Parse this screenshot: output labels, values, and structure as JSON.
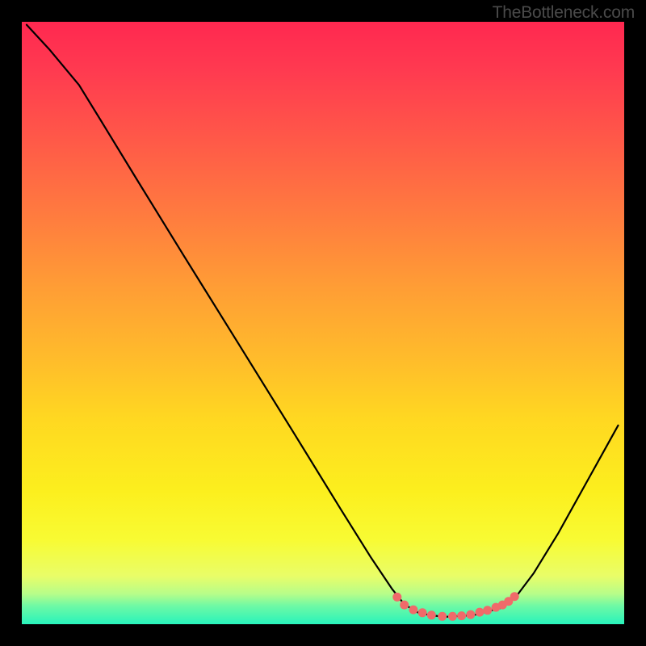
{
  "watermark": "TheBottleneck.com",
  "chart_data": {
    "type": "line",
    "title": "",
    "xlabel": "",
    "ylabel": "",
    "xlim": [
      0,
      100
    ],
    "ylim": [
      0,
      100
    ],
    "curve": [
      {
        "x": 0.8,
        "y": 99.5
      },
      {
        "x": 4.5,
        "y": 95.5
      },
      {
        "x": 9.5,
        "y": 89.5
      },
      {
        "x": 13.5,
        "y": 83.0
      },
      {
        "x": 19.0,
        "y": 74.0
      },
      {
        "x": 27.0,
        "y": 61.0
      },
      {
        "x": 36.0,
        "y": 46.5
      },
      {
        "x": 45.0,
        "y": 32.0
      },
      {
        "x": 53.0,
        "y": 19.0
      },
      {
        "x": 58.0,
        "y": 11.0
      },
      {
        "x": 61.5,
        "y": 5.8
      },
      {
        "x": 63.5,
        "y": 3.3
      },
      {
        "x": 66.0,
        "y": 1.8
      },
      {
        "x": 70.0,
        "y": 1.2
      },
      {
        "x": 75.0,
        "y": 1.5
      },
      {
        "x": 79.5,
        "y": 2.7
      },
      {
        "x": 82.0,
        "y": 4.5
      },
      {
        "x": 85.0,
        "y": 8.5
      },
      {
        "x": 89.0,
        "y": 15.0
      },
      {
        "x": 94.0,
        "y": 24.0
      },
      {
        "x": 99.0,
        "y": 33.0
      }
    ],
    "markers": [
      {
        "x": 62.3,
        "y": 4.5
      },
      {
        "x": 63.5,
        "y": 3.2
      },
      {
        "x": 65.0,
        "y": 2.4
      },
      {
        "x": 66.5,
        "y": 1.9
      },
      {
        "x": 68.0,
        "y": 1.5
      },
      {
        "x": 69.8,
        "y": 1.3
      },
      {
        "x": 71.5,
        "y": 1.3
      },
      {
        "x": 73.0,
        "y": 1.4
      },
      {
        "x": 74.5,
        "y": 1.6
      },
      {
        "x": 76.0,
        "y": 2.0
      },
      {
        "x": 77.3,
        "y": 2.3
      },
      {
        "x": 78.7,
        "y": 2.8
      },
      {
        "x": 79.8,
        "y": 3.2
      },
      {
        "x": 80.8,
        "y": 3.8
      },
      {
        "x": 81.8,
        "y": 4.6
      }
    ],
    "background_gradient": {
      "top": "#ff2850",
      "mid": "#fde235",
      "bottom": "#28f3bc"
    },
    "curve_color": "#000000",
    "marker_color": "#f06a6a"
  }
}
